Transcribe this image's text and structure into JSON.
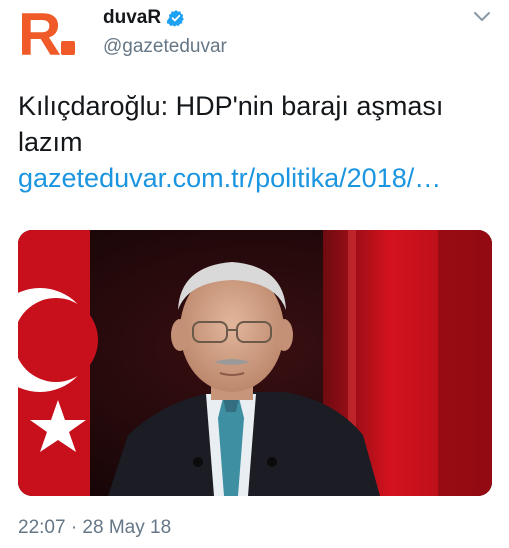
{
  "tweet": {
    "avatar_letter": "R",
    "display_name": "duvaR",
    "handle": "@gazeteduvar",
    "text_plain": "Kılıçdaroğlu: HDP'nin barajı aşması lazım ",
    "link_text": "gazeteduvar.com.tr/politika/2018/…",
    "timestamp": "22:07 · 28 May 18"
  },
  "icons": {
    "verified": "verified-badge-icon",
    "menu": "chevron-down-icon"
  },
  "colors": {
    "brand_orange": "#f05a28",
    "verified_blue": "#1da1f2",
    "link_blue": "#1b95e0",
    "secondary_text": "#657786"
  }
}
